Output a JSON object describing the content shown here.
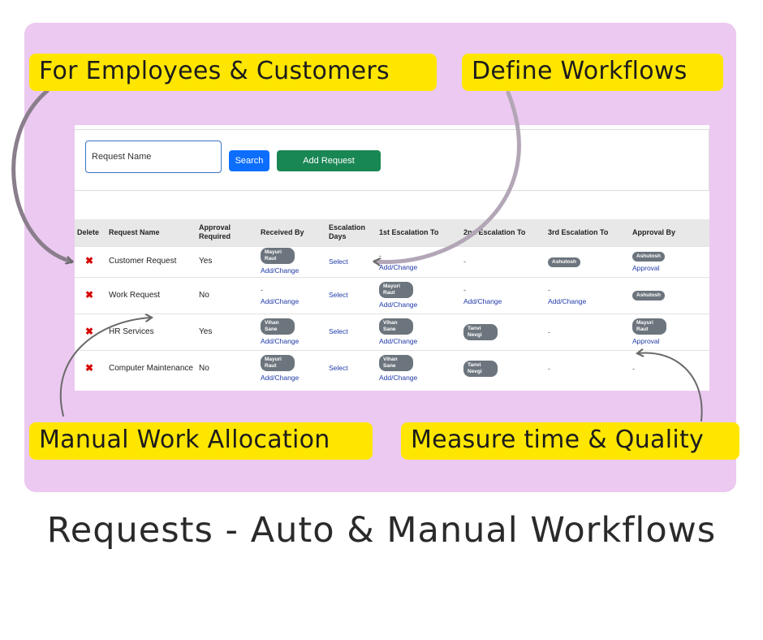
{
  "callouts": {
    "employees": "For Employees & Customers",
    "workflows": "Define Workflows",
    "manual": "Manual Work Allocation",
    "measure": "Measure time & Quality"
  },
  "search": {
    "placeholder": "Request Name",
    "search_label": "Search",
    "add_label": "Add Request"
  },
  "table": {
    "headers": {
      "delete": "Delete",
      "name": "Request Name",
      "approval_required": "Approval Required",
      "received_by": "Received By",
      "escalation_days": "Escalation Days",
      "esc1": "1st Escalation To",
      "esc2": "2nd Escalation To",
      "esc3": "3rd Escalation To",
      "approval_by": "Approval By"
    },
    "delete_glyph": "✖",
    "add_change": "Add/Change",
    "approval_link": "Approval",
    "select_label": "Select",
    "dash": "-",
    "rows": [
      {
        "name": "Customer Request",
        "approval_required": "Yes",
        "received_by": "Mayuri Raut",
        "esc1": "-",
        "esc2": "-",
        "esc3": "Ashutosh",
        "approval_by": "Ashutosh"
      },
      {
        "name": "Work Request",
        "approval_required": "No",
        "received_by": "-",
        "esc1": "Mayuri Raut",
        "esc2": "-",
        "esc3": "-",
        "approval_by": "Ashutosh"
      },
      {
        "name": "HR Services",
        "approval_required": "Yes",
        "received_by": "Vihan Sane",
        "esc1": "Vihan Sane",
        "esc2": "Tanvi Nevgi",
        "esc3": "-",
        "approval_by": "Mayuri Raut"
      },
      {
        "name": "Computer Maintenance",
        "approval_required": "No",
        "received_by": "Mayuri Raut",
        "esc1": "Vihan Sane",
        "esc2": "Tanvi Nevgi",
        "esc3": "-",
        "approval_by": "-"
      }
    ]
  },
  "footer": {
    "title": "Requests - Auto & Manual Workflows"
  },
  "colors": {
    "panel": "#ecc9f0",
    "callout": "#ffe600",
    "search_button": "#0d6efd",
    "add_button": "#198754",
    "badge": "#6c757d",
    "delete_icon": "#d60000"
  }
}
